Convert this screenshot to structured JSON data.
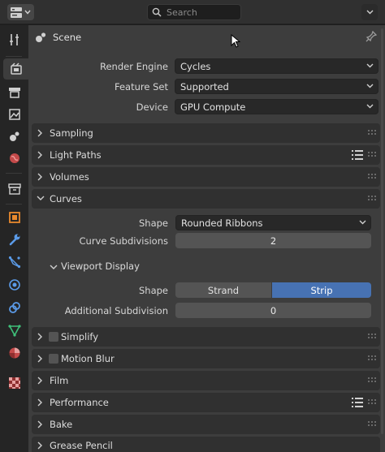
{
  "header": {
    "search_placeholder": "Search"
  },
  "tabs": [
    {
      "name": "tool-tab",
      "icon": "tool-icon"
    },
    {
      "name": "render-tab",
      "icon": "render-icon",
      "active": true
    },
    {
      "name": "output-tab",
      "icon": "output-icon"
    },
    {
      "name": "view-layer-tab",
      "icon": "view-layer-icon"
    },
    {
      "name": "scene-tab",
      "icon": "scene-icon"
    },
    {
      "name": "world-tab",
      "icon": "world-icon"
    },
    {
      "name": "collection-tab",
      "icon": "collection-icon"
    },
    {
      "name": "object-tab",
      "icon": "object-icon"
    },
    {
      "name": "modifier-tab",
      "icon": "wrench-icon"
    },
    {
      "name": "particles-tab",
      "icon": "particles-icon"
    },
    {
      "name": "physics-tab",
      "icon": "physics-icon"
    },
    {
      "name": "constraints-tab",
      "icon": "constraints-icon"
    },
    {
      "name": "data-tab",
      "icon": "data-icon"
    },
    {
      "name": "material-tab",
      "icon": "material-icon"
    },
    {
      "name": "texture-tab",
      "icon": "texture-icon"
    }
  ],
  "context": {
    "title": "Scene"
  },
  "render": {
    "engine_label": "Render Engine",
    "engine_value": "Cycles",
    "feature_set_label": "Feature Set",
    "feature_set_value": "Supported",
    "device_label": "Device",
    "device_value": "GPU Compute"
  },
  "sections": {
    "sampling": "Sampling",
    "light_paths": "Light Paths",
    "volumes": "Volumes",
    "curves": "Curves",
    "simplify": "Simplify",
    "motion_blur": "Motion Blur",
    "film": "Film",
    "performance": "Performance",
    "bake": "Bake",
    "grease_pencil": "Grease Pencil"
  },
  "curves": {
    "shape_label": "Shape",
    "shape_value": "Rounded Ribbons",
    "subdivisions_label": "Curve Subdivisions",
    "subdivisions_value": "2",
    "viewport_display": {
      "title": "Viewport Display",
      "shape_label": "Shape",
      "options": [
        "Strand",
        "Strip"
      ],
      "selected": "Strip",
      "additional_subdivision_label": "Additional Subdivision",
      "additional_subdivision_value": "0"
    }
  },
  "colors": {
    "accent": "#4772b3",
    "panel": "#3d3d3d",
    "section_header": "#303030",
    "field": "#545454"
  }
}
